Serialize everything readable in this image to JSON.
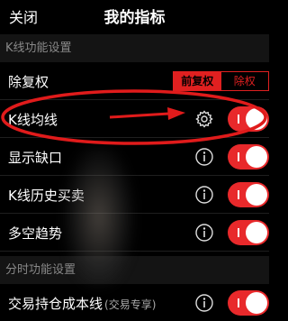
{
  "nav": {
    "close_label": "关闭",
    "title": "我的指标"
  },
  "sections": [
    {
      "header": "K线功能设置"
    },
    {
      "header": "分时功能设置"
    }
  ],
  "rows": {
    "adjust": {
      "label": "除复权",
      "options": [
        "前复权",
        "除权"
      ],
      "selected": "前复权"
    },
    "kline_ma": {
      "label": "K线均线",
      "icon": "gear-icon",
      "toggle_on": true
    },
    "show_gap": {
      "label": "显示缺口",
      "icon": "info-icon",
      "toggle_on": true
    },
    "kline_history": {
      "label": "K线历史买卖",
      "icon": "info-icon",
      "toggle_on": true
    },
    "long_short": {
      "label": "多空趋势",
      "icon": "info-icon",
      "toggle_on": true
    },
    "cost_line": {
      "label": "交易持仓成本线",
      "sub": "(交易专享)",
      "icon": "info-icon",
      "toggle_on": true
    }
  },
  "colors": {
    "accent_red": "#e02020",
    "toggle_red": "#e8292b",
    "annotation_red": "#e01b1b"
  }
}
